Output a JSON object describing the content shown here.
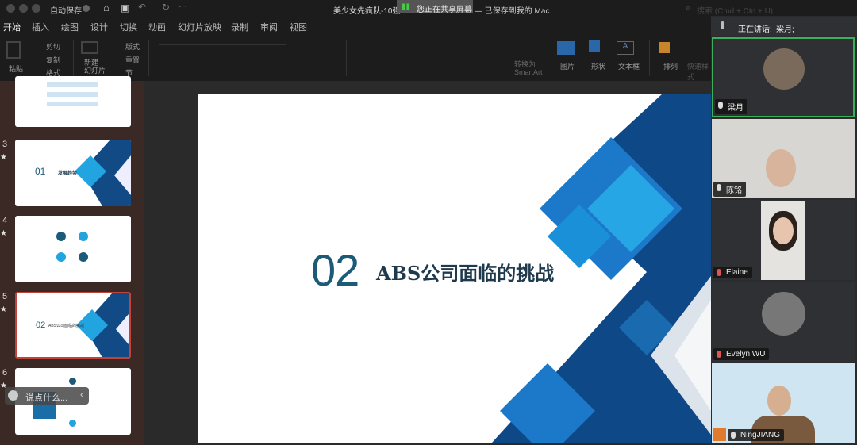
{
  "titlebar": {
    "autosave_label": "自动保存",
    "doc_title": "美少女先疯队-10强",
    "sharing_badge": "您正在共享屏幕",
    "saved_status": "— 已保存到我的 Mac",
    "search_placeholder": "搜索 (Cmd + Ctrl + U)"
  },
  "tabs": [
    "开始",
    "插入",
    "绘图",
    "设计",
    "切换",
    "动画",
    "幻灯片放映",
    "录制",
    "审阅",
    "视图"
  ],
  "ribbon": {
    "paste": "粘贴",
    "cut": "剪切",
    "copy": "复制",
    "format": "格式",
    "new_slide": "新建\n幻灯片",
    "layout": "版式",
    "reset": "重置",
    "section": "节",
    "smartart": "转换为\nSmartArt",
    "picture": "图片",
    "shape": "形状",
    "textbox": "文本框",
    "arrange": "排列",
    "quick_styles": "快速样式"
  },
  "slides": [
    {
      "number": "3",
      "title_num": "01",
      "title": "发展趋势"
    },
    {
      "number": "4"
    },
    {
      "number": "5",
      "title_num": "02",
      "title": "ABS公司面临的挑战"
    },
    {
      "number": "6"
    }
  ],
  "current_slide": {
    "number": "02",
    "title": "ABS公司面临的挑战"
  },
  "chat": {
    "placeholder": "说点什么..."
  },
  "meeting": {
    "speaking_label": "正在讲话:",
    "speaker": "梁月;",
    "participants": [
      {
        "name": "梁月",
        "muted": false
      },
      {
        "name": "陈铭",
        "muted": false
      },
      {
        "name": "Elaine",
        "muted": true
      },
      {
        "name": "Evelyn WU",
        "muted": true
      },
      {
        "name": "NingJIANG",
        "muted": false
      }
    ]
  },
  "colors": {
    "accent": "#1b5b78",
    "slide_blue": "#0d4d8c",
    "speaker_border": "#3fae5a"
  }
}
